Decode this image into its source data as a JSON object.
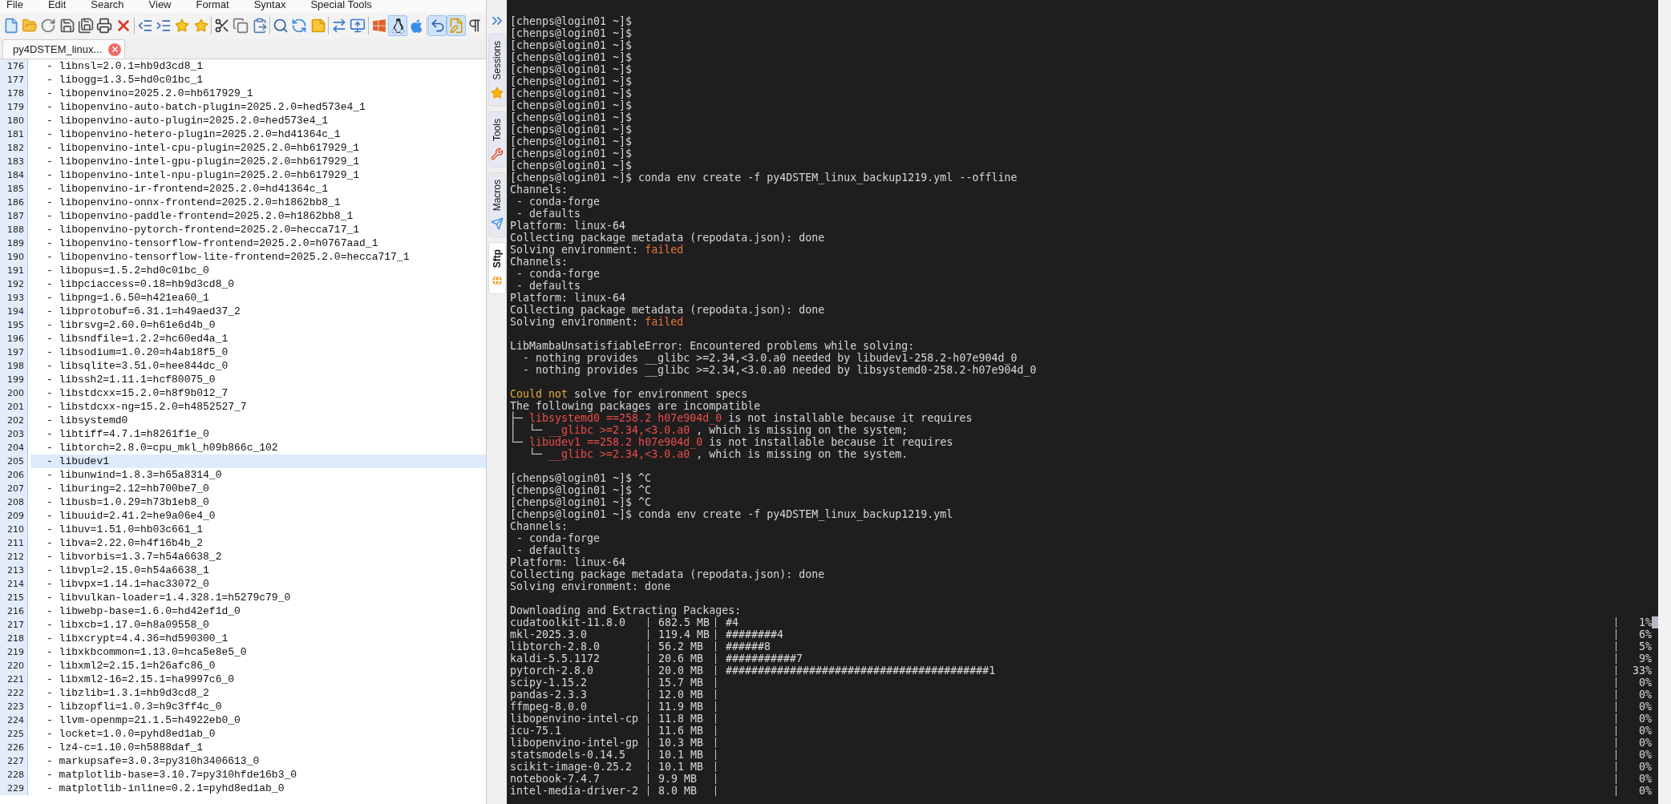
{
  "menu": [
    "File",
    "Edit",
    "Search",
    "View",
    "Format",
    "Syntax",
    "Special Tools"
  ],
  "toolbar": [
    {
      "pressed": false
    },
    {
      "pressed": false
    },
    {
      "pressed": false
    },
    {
      "pressed": false
    },
    {
      "pressed": false
    },
    {
      "pressed": false
    },
    {
      "pressed": false
    },
    {
      "pressed": false
    },
    {
      "pressed": false
    },
    {
      "pressed": false
    },
    {
      "pressed": false
    },
    {
      "pressed": false
    },
    {
      "pressed": false
    },
    {
      "pressed": false
    },
    {
      "pressed": false
    },
    {
      "pressed": false
    },
    {
      "pressed": false
    },
    {
      "pressed": false
    },
    {
      "pressed": false
    },
    {
      "pressed": false
    },
    {
      "pressed": true
    },
    {
      "pressed": false
    },
    {
      "pressed": true
    },
    {
      "pressed": true
    },
    {
      "pressed": false
    }
  ],
  "file_tab": {
    "label": "py4DSTEM_linux..."
  },
  "editor": {
    "lines": [
      {
        "number": "176",
        "text": "- libnsl=2.0.1=hb9d3cd8_1",
        "current": false
      },
      {
        "number": "177",
        "text": "- libogg=1.3.5=hd0c01bc_1",
        "current": false
      },
      {
        "number": "178",
        "text": "- libopenvino=2025.2.0=hb617929_1",
        "current": false
      },
      {
        "number": "179",
        "text": "- libopenvino-auto-batch-plugin=2025.2.0=hed573e4_1",
        "current": false
      },
      {
        "number": "180",
        "text": "- libopenvino-auto-plugin=2025.2.0=hed573e4_1",
        "current": false
      },
      {
        "number": "181",
        "text": "- libopenvino-hetero-plugin=2025.2.0=hd41364c_1",
        "current": false
      },
      {
        "number": "182",
        "text": "- libopenvino-intel-cpu-plugin=2025.2.0=hb617929_1",
        "current": false
      },
      {
        "number": "183",
        "text": "- libopenvino-intel-gpu-plugin=2025.2.0=hb617929_1",
        "current": false
      },
      {
        "number": "184",
        "text": "- libopenvino-intel-npu-plugin=2025.2.0=hb617929_1",
        "current": false
      },
      {
        "number": "185",
        "text": "- libopenvino-ir-frontend=2025.2.0=hd41364c_1",
        "current": false
      },
      {
        "number": "186",
        "text": "- libopenvino-onnx-frontend=2025.2.0=h1862bb8_1",
        "current": false
      },
      {
        "number": "187",
        "text": "- libopenvino-paddle-frontend=2025.2.0=h1862bb8_1",
        "current": false
      },
      {
        "number": "188",
        "text": "- libopenvino-pytorch-frontend=2025.2.0=hecca717_1",
        "current": false
      },
      {
        "number": "189",
        "text": "- libopenvino-tensorflow-frontend=2025.2.0=h0767aad_1",
        "current": false
      },
      {
        "number": "190",
        "text": "- libopenvino-tensorflow-lite-frontend=2025.2.0=hecca717_1",
        "current": false
      },
      {
        "number": "191",
        "text": "- libopus=1.5.2=hd0c01bc_0",
        "current": false
      },
      {
        "number": "192",
        "text": "- libpciaccess=0.18=hb9d3cd8_0",
        "current": false
      },
      {
        "number": "193",
        "text": "- libpng=1.6.50=h421ea60_1",
        "current": false
      },
      {
        "number": "194",
        "text": "- libprotobuf=6.31.1=h49aed37_2",
        "current": false
      },
      {
        "number": "195",
        "text": "- librsvg=2.60.0=h61e6d4b_0",
        "current": false
      },
      {
        "number": "196",
        "text": "- libsndfile=1.2.2=hc60ed4a_1",
        "current": false
      },
      {
        "number": "197",
        "text": "- libsodium=1.0.20=h4ab18f5_0",
        "current": false
      },
      {
        "number": "198",
        "text": "- libsqlite=3.51.0=hee844dc_0",
        "current": false
      },
      {
        "number": "199",
        "text": "- libssh2=1.11.1=hcf80075_0",
        "current": false
      },
      {
        "number": "200",
        "text": "- libstdcxx=15.2.0=h8f9b012_7",
        "current": false
      },
      {
        "number": "201",
        "text": "- libstdcxx-ng=15.2.0=h4852527_7",
        "current": false
      },
      {
        "number": "202",
        "text": "- libsystemd0",
        "current": false
      },
      {
        "number": "203",
        "text": "- libtiff=4.7.1=h8261f1e_0",
        "current": false
      },
      {
        "number": "204",
        "text": "- libtorch=2.8.0=cpu_mkl_h09b866c_102",
        "current": false
      },
      {
        "number": "205",
        "text": "- libudev1",
        "current": true
      },
      {
        "number": "206",
        "text": "- libunwind=1.8.3=h65a8314_0",
        "current": false
      },
      {
        "number": "207",
        "text": "- liburing=2.12=hb700be7_0",
        "current": false
      },
      {
        "number": "208",
        "text": "- libusb=1.0.29=h73b1eb8_0",
        "current": false
      },
      {
        "number": "209",
        "text": "- libuuid=2.41.2=he9a06e4_0",
        "current": false
      },
      {
        "number": "210",
        "text": "- libuv=1.51.0=hb03c661_1",
        "current": false
      },
      {
        "number": "211",
        "text": "- libva=2.22.0=h4f16b4b_2",
        "current": false
      },
      {
        "number": "212",
        "text": "- libvorbis=1.3.7=h54a6638_2",
        "current": false
      },
      {
        "number": "213",
        "text": "- libvpl=2.15.0=h54a6638_1",
        "current": false
      },
      {
        "number": "214",
        "text": "- libvpx=1.14.1=hac33072_0",
        "current": false
      },
      {
        "number": "215",
        "text": "- libvulkan-loader=1.4.328.1=h5279c79_0",
        "current": false
      },
      {
        "number": "216",
        "text": "- libwebp-base=1.6.0=hd42ef1d_0",
        "current": false
      },
      {
        "number": "217",
        "text": "- libxcb=1.17.0=h8a09558_0",
        "current": false
      },
      {
        "number": "218",
        "text": "- libxcrypt=4.4.36=hd590300_1",
        "current": false
      },
      {
        "number": "219",
        "text": "- libxkbcommon=1.13.0=hca5e8e5_0",
        "current": false
      },
      {
        "number": "220",
        "text": "- libxml2=2.15.1=h26afc86_0",
        "current": false
      },
      {
        "number": "221",
        "text": "- libxml2-16=2.15.1=ha9997c6_0",
        "current": false
      },
      {
        "number": "222",
        "text": "- libzlib=1.3.1=hb9d3cd8_2",
        "current": false
      },
      {
        "number": "223",
        "text": "- libzopfli=1.0.3=h9c3ff4c_0",
        "current": false
      },
      {
        "number": "224",
        "text": "- llvm-openmp=21.1.5=h4922eb0_0",
        "current": false
      },
      {
        "number": "225",
        "text": "- locket=1.0.0=pyhd8ed1ab_0",
        "current": false
      },
      {
        "number": "226",
        "text": "- lz4-c=1.10.0=h5888daf_1",
        "current": false
      },
      {
        "number": "227",
        "text": "- markupsafe=3.0.3=py310h3406613_0",
        "current": false
      },
      {
        "number": "228",
        "text": "- matplotlib-base=3.10.7=py310hfde16b3_0",
        "current": false
      },
      {
        "number": "229",
        "text": "- matplotlib-inline=0.2.1=pyhd8ed1ab_0",
        "current": false
      }
    ]
  },
  "side_panel": {
    "tabs": [
      {
        "label": "Sessions",
        "selected": false
      },
      {
        "label": "Tools",
        "selected": false
      },
      {
        "label": "Macros",
        "selected": false
      },
      {
        "label": "Sftp",
        "selected": true
      }
    ]
  },
  "terminal": {
    "lines": [
      {
        "kind": "text",
        "parts": [
          {
            "text": "[chenps@login01 ~]$"
          }
        ]
      },
      {
        "kind": "text",
        "parts": [
          {
            "text": "[chenps@login01 ~]$"
          }
        ]
      },
      {
        "kind": "text",
        "parts": [
          {
            "text": "[chenps@login01 ~]$"
          }
        ]
      },
      {
        "kind": "text",
        "parts": [
          {
            "text": "[chenps@login01 ~]$"
          }
        ]
      },
      {
        "kind": "text",
        "parts": [
          {
            "text": "[chenps@login01 ~]$"
          }
        ]
      },
      {
        "kind": "text",
        "parts": [
          {
            "text": "[chenps@login01 ~]$"
          }
        ]
      },
      {
        "kind": "text",
        "parts": [
          {
            "text": "[chenps@login01 ~]$"
          }
        ]
      },
      {
        "kind": "text",
        "parts": [
          {
            "text": "[chenps@login01 ~]$"
          }
        ]
      },
      {
        "kind": "text",
        "parts": [
          {
            "text": "[chenps@login01 ~]$"
          }
        ]
      },
      {
        "kind": "text",
        "parts": [
          {
            "text": "[chenps@login01 ~]$"
          }
        ]
      },
      {
        "kind": "text",
        "parts": [
          {
            "text": "[chenps@login01 ~]$"
          }
        ]
      },
      {
        "kind": "text",
        "parts": [
          {
            "text": "[chenps@login01 ~]$"
          }
        ]
      },
      {
        "kind": "text",
        "parts": [
          {
            "text": "[chenps@login01 ~]$"
          }
        ]
      },
      {
        "kind": "text",
        "parts": [
          {
            "text": "[chenps@login01 ~]$ conda env create -f py4DSTEM_linux_backup1219.yml --offline"
          }
        ]
      },
      {
        "kind": "text",
        "parts": [
          {
            "text": "Channels:"
          }
        ]
      },
      {
        "kind": "text",
        "parts": [
          {
            "text": " - conda-forge"
          }
        ]
      },
      {
        "kind": "text",
        "parts": [
          {
            "text": " - defaults"
          }
        ]
      },
      {
        "kind": "text",
        "parts": [
          {
            "text": "Platform: linux-64"
          }
        ]
      },
      {
        "kind": "text",
        "parts": [
          {
            "text": "Collecting package metadata (repodata.json): done"
          }
        ]
      },
      {
        "kind": "text",
        "parts": [
          {
            "text": "Solving environment: "
          },
          {
            "text": "failed",
            "color": "#e8743b"
          }
        ]
      },
      {
        "kind": "text",
        "parts": [
          {
            "text": "Channels:"
          }
        ]
      },
      {
        "kind": "text",
        "parts": [
          {
            "text": " - conda-forge"
          }
        ]
      },
      {
        "kind": "text",
        "parts": [
          {
            "text": " - defaults"
          }
        ]
      },
      {
        "kind": "text",
        "parts": [
          {
            "text": "Platform: linux-64"
          }
        ]
      },
      {
        "kind": "text",
        "parts": [
          {
            "text": "Collecting package metadata (repodata.json): done"
          }
        ]
      },
      {
        "kind": "text",
        "parts": [
          {
            "text": "Solving environment: "
          },
          {
            "text": "failed",
            "color": "#e8743b"
          }
        ]
      },
      {
        "kind": "blank"
      },
      {
        "kind": "text",
        "parts": [
          {
            "text": "LibMambaUnsatisfiableError: Encountered problems while solving:"
          }
        ]
      },
      {
        "kind": "text",
        "parts": [
          {
            "text": "  - nothing provides __glibc >=2.34,<3.0.a0 needed by libudev1-258.2-h07e904d_0"
          }
        ]
      },
      {
        "kind": "text",
        "parts": [
          {
            "text": "  - nothing provides __glibc >=2.34,<3.0.a0 needed by libsystemd0-258.2-h07e904d_0"
          }
        ]
      },
      {
        "kind": "blank"
      },
      {
        "kind": "text",
        "parts": [
          {
            "text": "Could not",
            "color": "#e6a93a"
          },
          {
            "text": " solve for environment specs"
          }
        ]
      },
      {
        "kind": "text",
        "parts": [
          {
            "text": "The following packages are incompatible"
          }
        ]
      },
      {
        "kind": "text",
        "parts": [
          {
            "text": "├─ "
          },
          {
            "text": "libsystemd0 ==258.2 h07e904d_0",
            "color": "#ec4b4b"
          },
          {
            "text": " is not installable because it requires"
          }
        ]
      },
      {
        "kind": "text",
        "parts": [
          {
            "text": "│  └─ "
          },
          {
            "text": "__glibc >=2.34,<3.0.a0",
            "color": "#ec4b4b"
          },
          {
            "text": " , which is missing on the system;"
          }
        ]
      },
      {
        "kind": "text",
        "parts": [
          {
            "text": "└─ "
          },
          {
            "text": "libudev1 ==258.2 h07e904d_0",
            "color": "#ec4b4b"
          },
          {
            "text": " is not installable because it requires"
          }
        ]
      },
      {
        "kind": "text",
        "parts": [
          {
            "text": "   └─ "
          },
          {
            "text": "__glibc >=2.34,<3.0.a0",
            "color": "#ec4b4b"
          },
          {
            "text": " , which is missing on the system."
          }
        ]
      },
      {
        "kind": "blank"
      },
      {
        "kind": "text",
        "parts": [
          {
            "text": "[chenps@login01 ~]$ ^C"
          }
        ]
      },
      {
        "kind": "text",
        "parts": [
          {
            "text": "[chenps@login01 ~]$ ^C"
          }
        ]
      },
      {
        "kind": "text",
        "parts": [
          {
            "text": "[chenps@login01 ~]$ ^C"
          }
        ]
      },
      {
        "kind": "text",
        "parts": [
          {
            "text": "[chenps@login01 ~]$ conda env create -f py4DSTEM_linux_backup1219.yml"
          }
        ]
      },
      {
        "kind": "text",
        "parts": [
          {
            "text": "Channels:"
          }
        ]
      },
      {
        "kind": "text",
        "parts": [
          {
            "text": " - conda-forge"
          }
        ]
      },
      {
        "kind": "text",
        "parts": [
          {
            "text": " - defaults"
          }
        ]
      },
      {
        "kind": "text",
        "parts": [
          {
            "text": "Platform: linux-64"
          }
        ]
      },
      {
        "kind": "text",
        "parts": [
          {
            "text": "Collecting package metadata (repodata.json): done"
          }
        ]
      },
      {
        "kind": "text",
        "parts": [
          {
            "text": "Solving environment: done"
          }
        ]
      },
      {
        "kind": "blank"
      },
      {
        "kind": "text",
        "parts": [
          {
            "text": "Downloading and Extracting Packages:"
          }
        ]
      }
    ],
    "downloads": [
      {
        "name": "cudatoolkit-11.8.0",
        "size": "682.5 MB",
        "bar": "#4",
        "percent": "1%",
        "cursor": true
      },
      {
        "name": "mkl-2025.3.0",
        "size": "119.4 MB",
        "bar": "########4",
        "percent": "6%"
      },
      {
        "name": "libtorch-2.8.0",
        "size": "56.2 MB",
        "bar": "######8",
        "percent": "5%"
      },
      {
        "name": "kaldi-5.5.1172",
        "size": "20.6 MB",
        "bar": "###########7",
        "percent": "9%"
      },
      {
        "name": "pytorch-2.8.0",
        "size": "20.0 MB",
        "bar": "#########################################1",
        "percent": "33%"
      },
      {
        "name": "scipy-1.15.2",
        "size": "15.7 MB",
        "percent": "0%"
      },
      {
        "name": "pandas-2.3.3",
        "size": "12.0 MB",
        "percent": "0%"
      },
      {
        "name": "ffmpeg-8.0.0",
        "size": "11.9 MB",
        "percent": "0%"
      },
      {
        "name": "libopenvino-intel-cp",
        "size": "11.8 MB",
        "percent": "0%"
      },
      {
        "name": "icu-75.1",
        "size": "11.6 MB",
        "percent": "0%"
      },
      {
        "name": "libopenvino-intel-gp",
        "size": "10.3 MB",
        "percent": "0%"
      },
      {
        "name": "statsmodels-0.14.5",
        "size": "10.1 MB",
        "percent": "0%"
      },
      {
        "name": "scikit-image-0.25.2",
        "size": "10.1 MB",
        "percent": "0%"
      },
      {
        "name": "notebook-7.4.7",
        "size": "9.9 MB",
        "percent": "0%"
      },
      {
        "name": "intel-media-driver-2",
        "size": "8.0 MB",
        "percent": "0%"
      }
    ]
  }
}
